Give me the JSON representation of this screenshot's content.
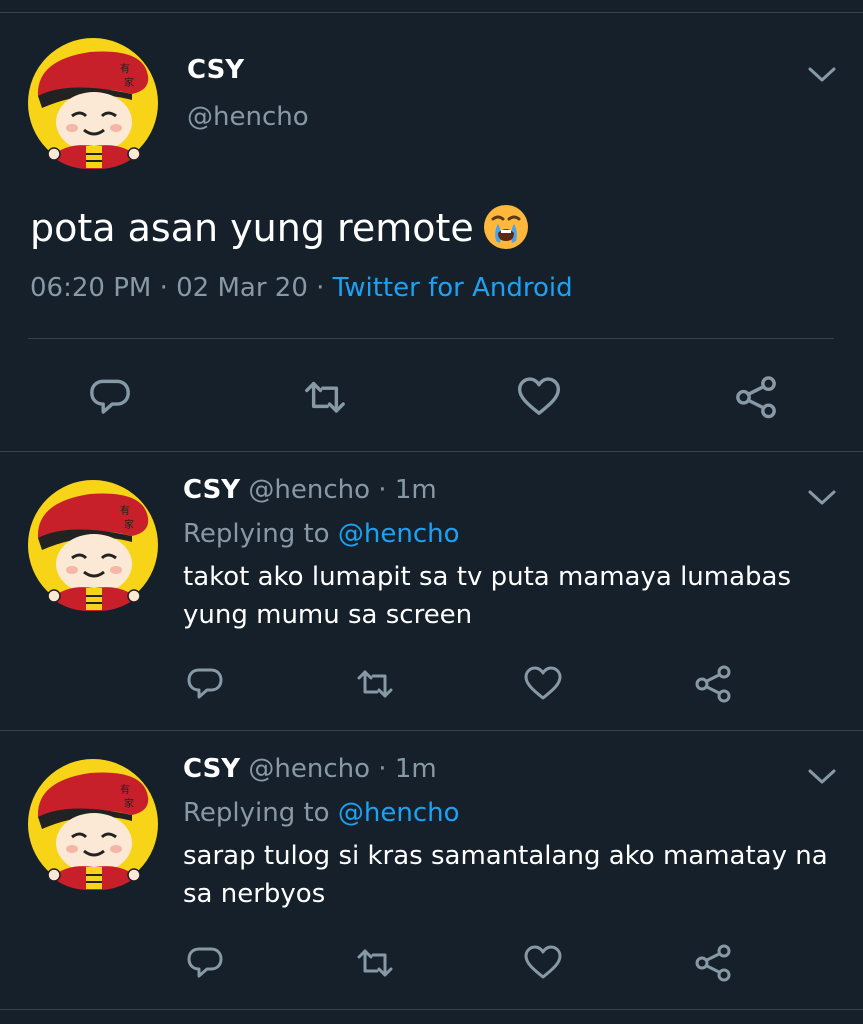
{
  "main_tweet": {
    "name": "CSY",
    "handle": "@hencho",
    "text": "pota asan yung remote",
    "emoji": "loudly-crying-face",
    "time": "06:20 PM",
    "date": "02 Mar 20",
    "source": "Twitter for Android",
    "separator": " · "
  },
  "replies": [
    {
      "name": "CSY",
      "handle": "@hencho",
      "age": "1m",
      "replying_label": "Replying to",
      "replying_to": "@hencho",
      "text": "takot ako lumapit sa tv puta mamaya lumabas yung mumu sa screen"
    },
    {
      "name": "CSY",
      "handle": "@hencho",
      "age": "1m",
      "replying_label": "Replying to",
      "replying_to": "@hencho",
      "text": "sarap tulog si kras samantalang ako mamatay na sa nerbyos"
    }
  ],
  "icons": {
    "reply": "reply-icon",
    "retweet": "retweet-icon",
    "like": "like-icon",
    "share": "share-icon",
    "more": "chevron-down-icon"
  },
  "colors": {
    "background": "#15202b",
    "divider": "#38444d",
    "secondary_text": "#8899a6",
    "link": "#1da1f2",
    "icon": "#8899a6"
  }
}
